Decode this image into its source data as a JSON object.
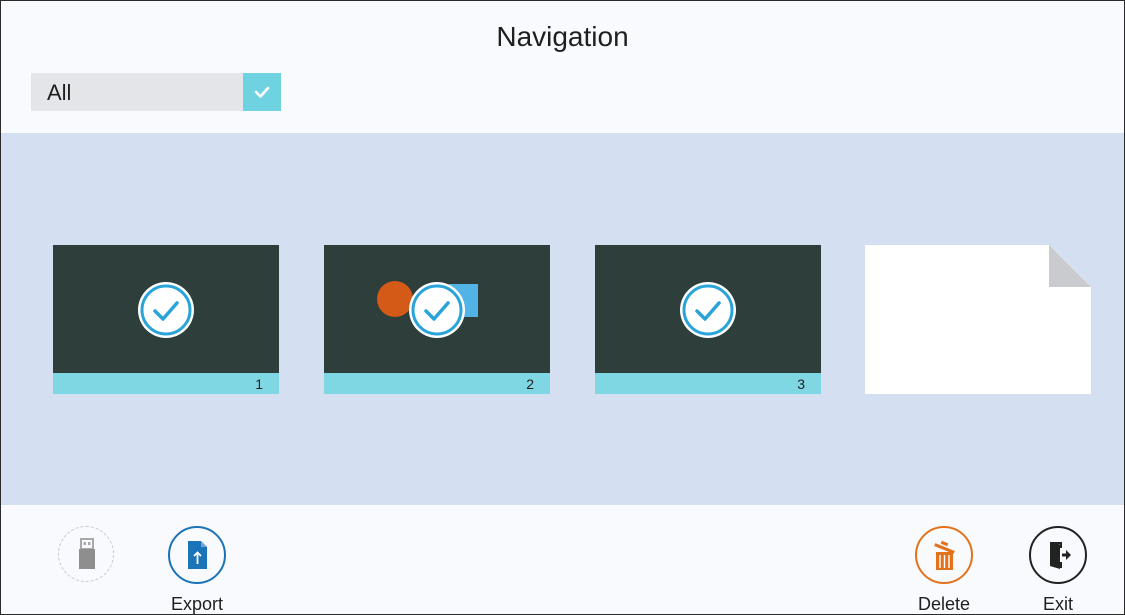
{
  "header": {
    "title": "Navigation",
    "filter": {
      "label": "All",
      "checked": true
    }
  },
  "pages": [
    {
      "number": "1",
      "selected": true,
      "shapes": []
    },
    {
      "number": "2",
      "selected": true,
      "shapes": [
        "orange-circle",
        "blue-square"
      ]
    },
    {
      "number": "3",
      "selected": true,
      "shapes": []
    }
  ],
  "new_page": {
    "icon": "blank-page-icon"
  },
  "toolbar": {
    "usb": {
      "icon": "usb-drive-icon",
      "enabled": false
    },
    "export": {
      "label": "Export",
      "icon": "export-file-icon"
    },
    "delete": {
      "label": "Delete",
      "icon": "trash-icon"
    },
    "exit": {
      "label": "Exit",
      "icon": "exit-door-icon"
    }
  },
  "colors": {
    "accent": "#6fd2e0",
    "thumb_bar": "#7fd7e4",
    "canvas": "#2e3e3a",
    "content_bg": "#d4dff2",
    "export_blue": "#1b73b8",
    "delete_orange": "#e2731c",
    "check_blue": "#2aa4d8"
  }
}
